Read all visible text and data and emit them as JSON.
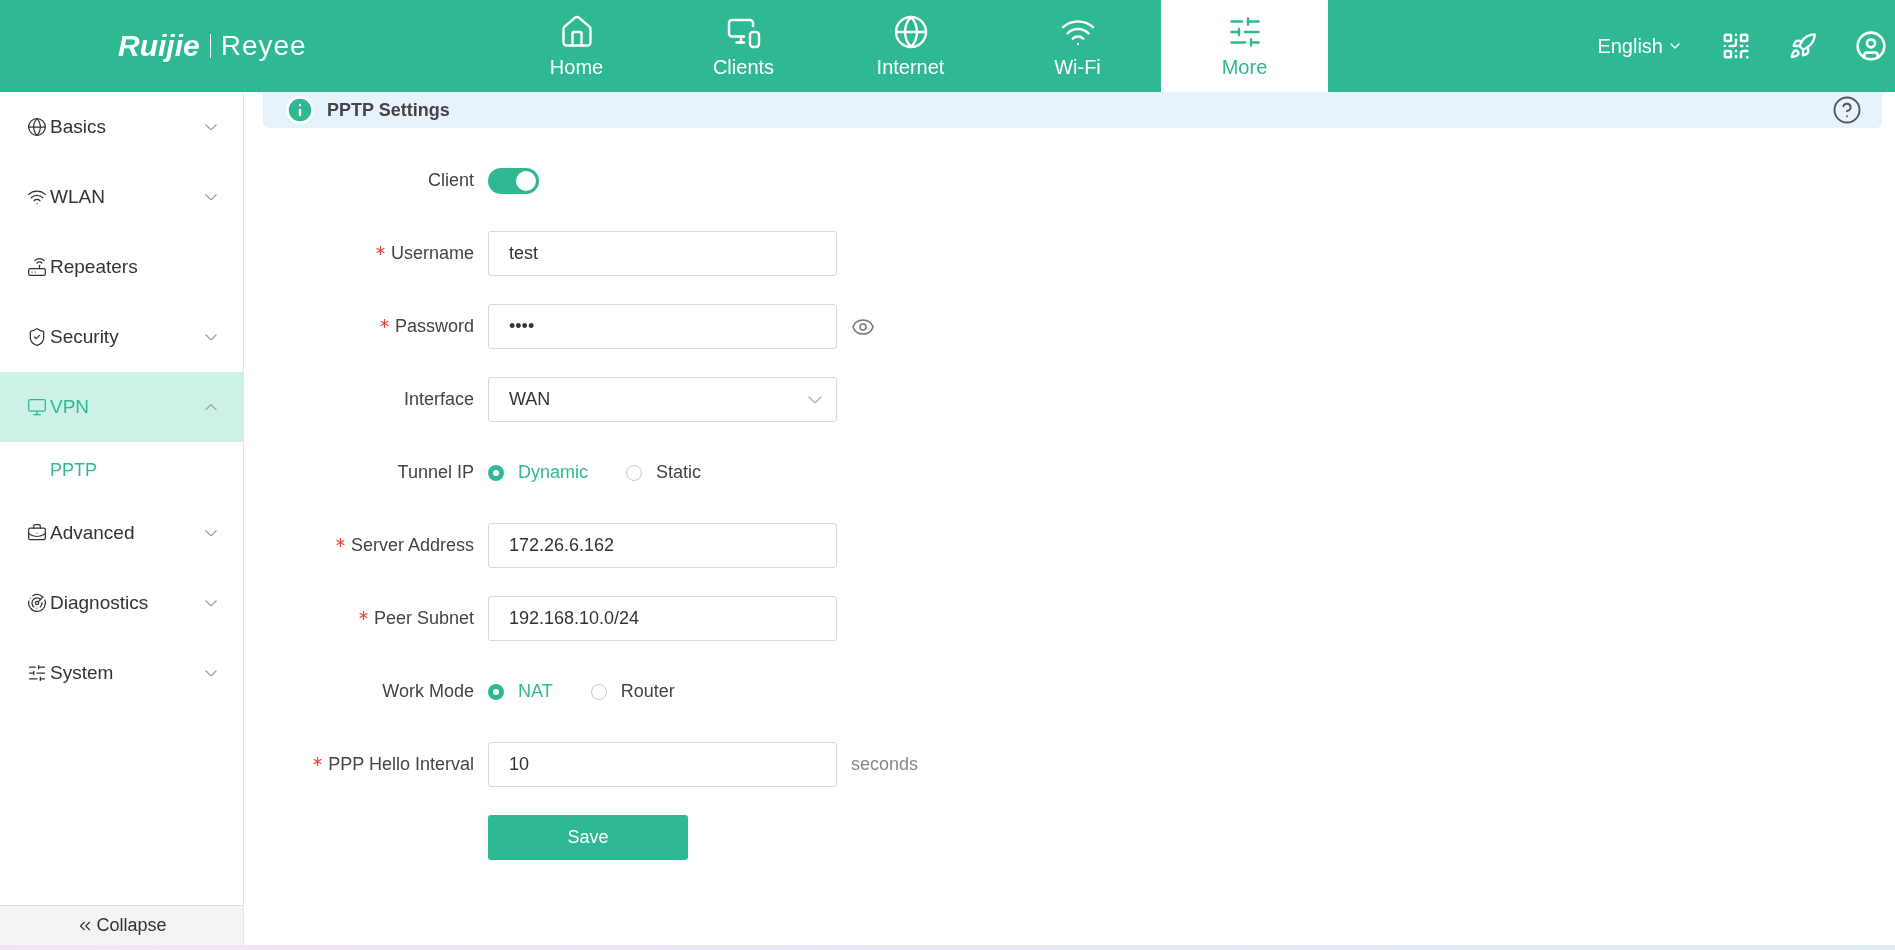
{
  "header": {
    "logo": {
      "brand": "Ruijie",
      "product": "Reyee"
    },
    "nav": [
      {
        "label": "Home",
        "selected": false
      },
      {
        "label": "Clients",
        "selected": false
      },
      {
        "label": "Internet",
        "selected": false
      },
      {
        "label": "Wi-Fi",
        "selected": false
      },
      {
        "label": "More",
        "selected": true
      }
    ],
    "language": "English"
  },
  "sidebar": {
    "items": [
      {
        "label": "Basics",
        "kind": "group",
        "expanded": false,
        "selected": false
      },
      {
        "label": "WLAN",
        "kind": "group",
        "expanded": false,
        "selected": false
      },
      {
        "label": "Repeaters",
        "kind": "link",
        "selected": false
      },
      {
        "label": "Security",
        "kind": "group",
        "expanded": false,
        "selected": false
      },
      {
        "label": "VPN",
        "kind": "group",
        "expanded": true,
        "selected": true,
        "children": [
          {
            "label": "PPTP",
            "selected": true
          }
        ]
      },
      {
        "label": "Advanced",
        "kind": "group",
        "expanded": false,
        "selected": false
      },
      {
        "label": "Diagnostics",
        "kind": "group",
        "expanded": false,
        "selected": false
      },
      {
        "label": "System",
        "kind": "group",
        "expanded": false,
        "selected": false
      }
    ],
    "collapse": "Collapse"
  },
  "section": {
    "title": "PPTP Settings"
  },
  "form": {
    "fields": [
      {
        "kind": "toggle",
        "label": "Client",
        "required": false,
        "on": true
      },
      {
        "kind": "text",
        "label": "Username",
        "required": true,
        "value": "test"
      },
      {
        "kind": "password",
        "label": "Password",
        "required": true,
        "value": "••••"
      },
      {
        "kind": "select",
        "label": "Interface",
        "required": false,
        "value": "WAN"
      },
      {
        "kind": "radio",
        "label": "Tunnel IP",
        "required": false,
        "options": [
          {
            "label": "Dynamic",
            "selected": true
          },
          {
            "label": "Static",
            "selected": false
          }
        ]
      },
      {
        "kind": "text",
        "label": "Server Address",
        "required": true,
        "value": "172.26.6.162"
      },
      {
        "kind": "text",
        "label": "Peer Subnet",
        "required": true,
        "value": "192.168.10.0/24"
      },
      {
        "kind": "radio",
        "label": "Work Mode",
        "required": false,
        "options": [
          {
            "label": "NAT",
            "selected": true
          },
          {
            "label": "Router",
            "selected": false
          }
        ]
      },
      {
        "kind": "text",
        "label": "PPP Hello Interval",
        "required": true,
        "value": "10",
        "suffix": "seconds"
      }
    ],
    "save": "Save"
  }
}
